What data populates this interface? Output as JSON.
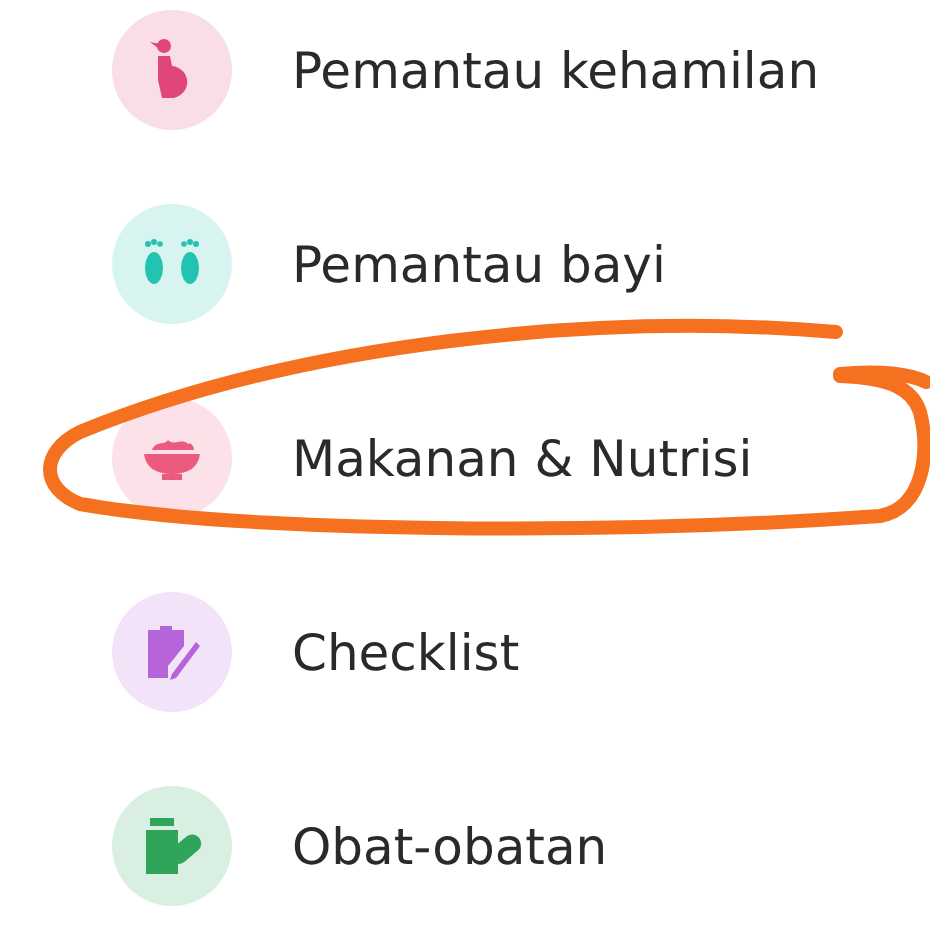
{
  "menu": [
    {
      "label": "Pemantau kehamilan",
      "kind": "pregnancy",
      "color": "#e0457b",
      "circled": false
    },
    {
      "label": "Pemantau bayi",
      "kind": "feet",
      "color": "#22c3b0",
      "circled": false
    },
    {
      "label": "Makanan & Nutrisi",
      "kind": "bowl",
      "color": "#ec5a80",
      "circled": true
    },
    {
      "label": "Checklist",
      "kind": "clipboard",
      "color": "#b565d9",
      "circled": false
    },
    {
      "label": "Obat-obatan",
      "kind": "medicine",
      "color": "#2fa55a",
      "circled": false
    }
  ]
}
